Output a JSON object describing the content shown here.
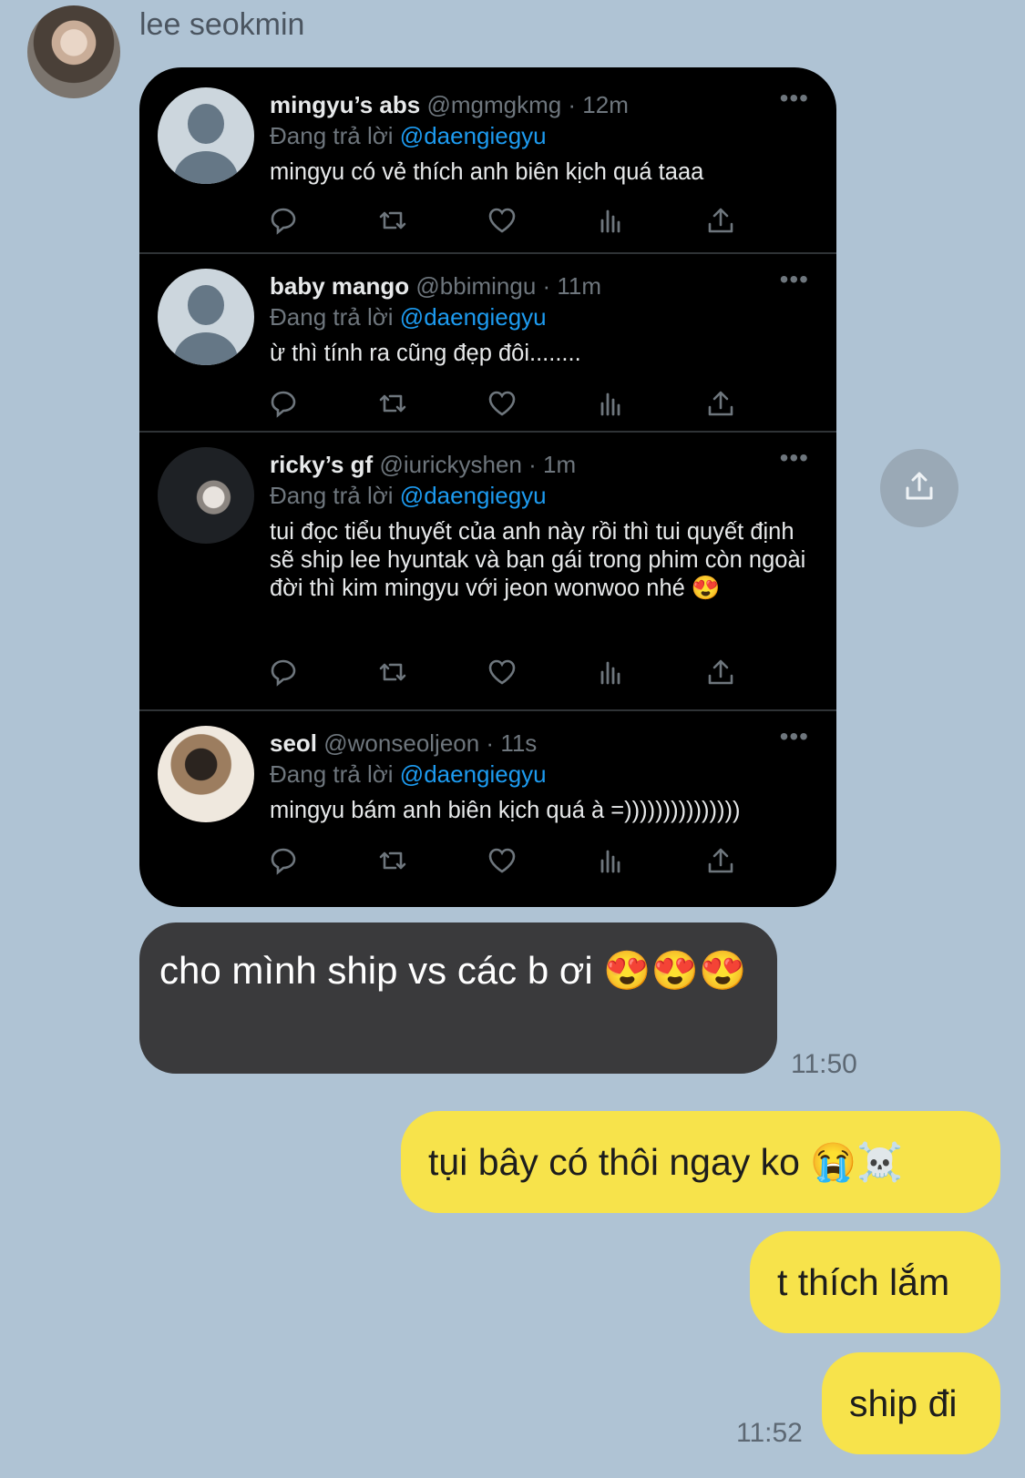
{
  "chat": {
    "sender_name": "lee seokmin",
    "incoming_message": "cho mình ship vs các b ơi 😍😍😍",
    "incoming_time": "11:50",
    "outgoing": [
      {
        "text": "tụi bây có thôi ngay ko 😭☠️"
      },
      {
        "text": "t thích lắm"
      },
      {
        "text": "ship đi"
      }
    ],
    "outgoing_time": "11:52"
  },
  "tweets": [
    {
      "name": "mingyu’s abs",
      "handle_time": "@mgmgkmg · 12m",
      "reply_prefix": "Đang trả lời",
      "mention": "@daengiegyu",
      "text": "mingyu có vẻ thích anh biên kịch quá taaa"
    },
    {
      "name": "baby mango",
      "handle_time": "@bbimingu · 11m",
      "reply_prefix": "Đang trả lời",
      "mention": "@daengiegyu",
      "text": "ừ thì tính ra cũng đẹp đôi........"
    },
    {
      "name": "ricky’s gf",
      "handle_time": "@iurickyshen · 1m",
      "reply_prefix": "Đang trả lời",
      "mention": "@daengiegyu",
      "text": "tui đọc tiểu thuyết của anh này rồi thì tui quyết định sẽ ship lee hyuntak và bạn gái trong phim còn ngoài đời thì kim mingyu với jeon wonwoo nhé 😍"
    },
    {
      "name": "seol",
      "handle_time": "@wonseoljeon · 11s",
      "reply_prefix": "Đang trả lời",
      "mention": "@daengiegyu",
      "text": "mingyu bám anh biên kịch quá à =)))))))))))))))"
    }
  ],
  "icons": [
    "reply-icon",
    "retweet-icon",
    "like-icon",
    "analytics-icon",
    "share-icon",
    "more-icon",
    "forward-icon"
  ],
  "colors": {
    "background": "#afc3d4",
    "outgoing_bubble": "#f7e34b",
    "incoming_bubble": "#3a3a3c",
    "mention": "#1d9bf0"
  }
}
